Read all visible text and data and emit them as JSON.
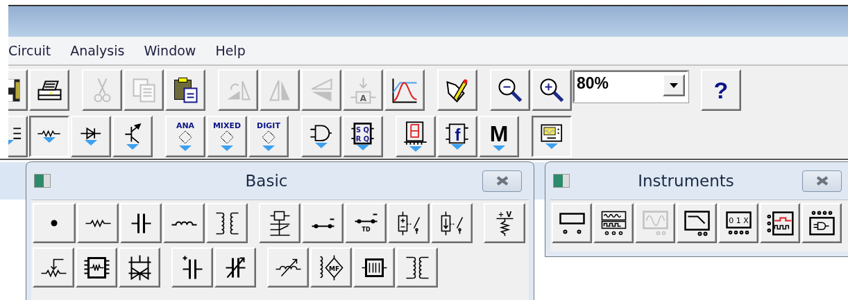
{
  "menu": [
    {
      "label": "Circuit"
    },
    {
      "label": "Analysis"
    },
    {
      "label": "Window"
    },
    {
      "label": "Help"
    }
  ],
  "main_toolbar": {
    "groups": [
      [
        {
          "kind": "save",
          "disabled": false
        },
        {
          "kind": "print",
          "disabled": false
        }
      ],
      [
        {
          "kind": "cut",
          "disabled": true
        },
        {
          "kind": "copy",
          "disabled": true
        },
        {
          "kind": "paste",
          "disabled": false
        }
      ],
      [
        {
          "kind": "rotate",
          "disabled": true
        },
        {
          "kind": "flip-horizontal",
          "disabled": true
        },
        {
          "kind": "flip-vertical",
          "disabled": true
        },
        {
          "kind": "subcircuit",
          "label": "A",
          "disabled": true
        },
        {
          "kind": "graph",
          "disabled": false
        }
      ],
      [
        {
          "kind": "description",
          "disabled": false
        }
      ],
      [
        {
          "kind": "zoom-out",
          "disabled": false
        },
        {
          "kind": "zoom-in",
          "disabled": false
        },
        {
          "kind": "zoom-select",
          "value": "80%",
          "disabled": false
        }
      ],
      [
        {
          "kind": "help",
          "label": "?",
          "disabled": false
        }
      ]
    ]
  },
  "parts_toolbar": {
    "groups": [
      [
        {
          "kind": "sources",
          "selected": false
        },
        {
          "kind": "basic",
          "selected": true
        },
        {
          "kind": "diodes",
          "selected": false
        },
        {
          "kind": "transistors",
          "selected": false
        }
      ],
      [
        {
          "kind": "chip",
          "label": "ANA",
          "selected": false
        },
        {
          "kind": "chip",
          "label": "MIXED",
          "selected": false
        },
        {
          "kind": "chip",
          "label": "DIGIT",
          "selected": false
        }
      ],
      [
        {
          "kind": "logic-gates",
          "selected": false
        },
        {
          "kind": "flip-flop",
          "labels": [
            "S Q",
            "R Q"
          ],
          "selected": false
        }
      ],
      [
        {
          "kind": "display",
          "selected": false
        },
        {
          "kind": "function-box",
          "label": "f",
          "selected": false
        },
        {
          "kind": "text-button",
          "label": "M",
          "selected": false
        }
      ],
      [
        {
          "kind": "instruments",
          "selected": true
        }
      ]
    ]
  },
  "basic_panel": {
    "title": "Basic",
    "rows": [
      {
        "groups": [
          [
            {
              "kind": "junction"
            },
            {
              "kind": "resistor"
            },
            {
              "kind": "capacitor"
            },
            {
              "kind": "inductor"
            },
            {
              "kind": "transformer"
            }
          ],
          [
            {
              "kind": "relay"
            },
            {
              "kind": "switch"
            },
            {
              "kind": "delay-switch",
              "label": "TD"
            },
            {
              "kind": "voltage-switch"
            },
            {
              "kind": "current-switch"
            }
          ],
          [
            {
              "kind": "pullup",
              "label": "+ V"
            }
          ]
        ]
      },
      {
        "groups": [
          [
            {
              "kind": "potentiometer"
            },
            {
              "kind": "resistor-pack"
            },
            {
              "kind": "analog-switch"
            }
          ],
          [
            {
              "kind": "polar-capacitor"
            },
            {
              "kind": "variable-capacitor"
            }
          ],
          [
            {
              "kind": "variable-inductor"
            },
            {
              "kind": "magnetic-core",
              "label": "MF"
            },
            {
              "kind": "coreless-coil"
            },
            {
              "kind": "nonlinear-transformer"
            }
          ]
        ]
      }
    ]
  },
  "instruments_panel": {
    "title": "Instruments",
    "items": [
      {
        "kind": "multimeter",
        "disabled": false
      },
      {
        "kind": "function-generator",
        "disabled": false
      },
      {
        "kind": "oscilloscope",
        "disabled": true
      },
      {
        "kind": "bode-plotter",
        "disabled": false
      },
      {
        "kind": "word-generator",
        "label": "0 1 X",
        "disabled": false
      },
      {
        "kind": "logic-analyzer",
        "disabled": false
      },
      {
        "kind": "logic-converter",
        "disabled": false
      }
    ]
  }
}
